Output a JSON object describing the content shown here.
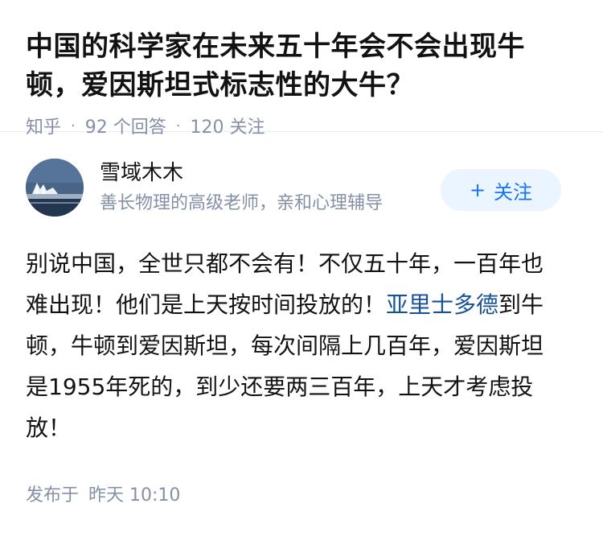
{
  "question": {
    "title": "中国的科学家在未来五十年会不会出现牛顿，爱因斯坦式标志性的大牛？",
    "source": "知乎",
    "answers_count": "92 个回答",
    "followers_count": "120 关注",
    "separator": "·"
  },
  "answer": {
    "author": {
      "name": "雪域木木",
      "bio": "善长物理的高级老师，亲和心理辅导",
      "avatar_icon": "avatar-photo-icon"
    },
    "follow": {
      "icon": "plus",
      "label": "关注"
    },
    "content": {
      "before_link": "别说中国，全世只都不会有！不仅五十年，一百年也难出现！他们是上天按时间投放的！",
      "link": "亚里士多德",
      "after_link": "到牛顿，牛顿到爱因斯坦，每次间隔上几百年，爱因斯坦是1955年死的，到少还要两三百年，上天才考虑投放！"
    },
    "published": {
      "label": "发布于",
      "time": "昨天 10:10"
    }
  },
  "colors": {
    "link": "#175199",
    "follow_text": "#1772f6",
    "follow_bg": "#ebf5ff",
    "meta_text": "#8590a6"
  }
}
